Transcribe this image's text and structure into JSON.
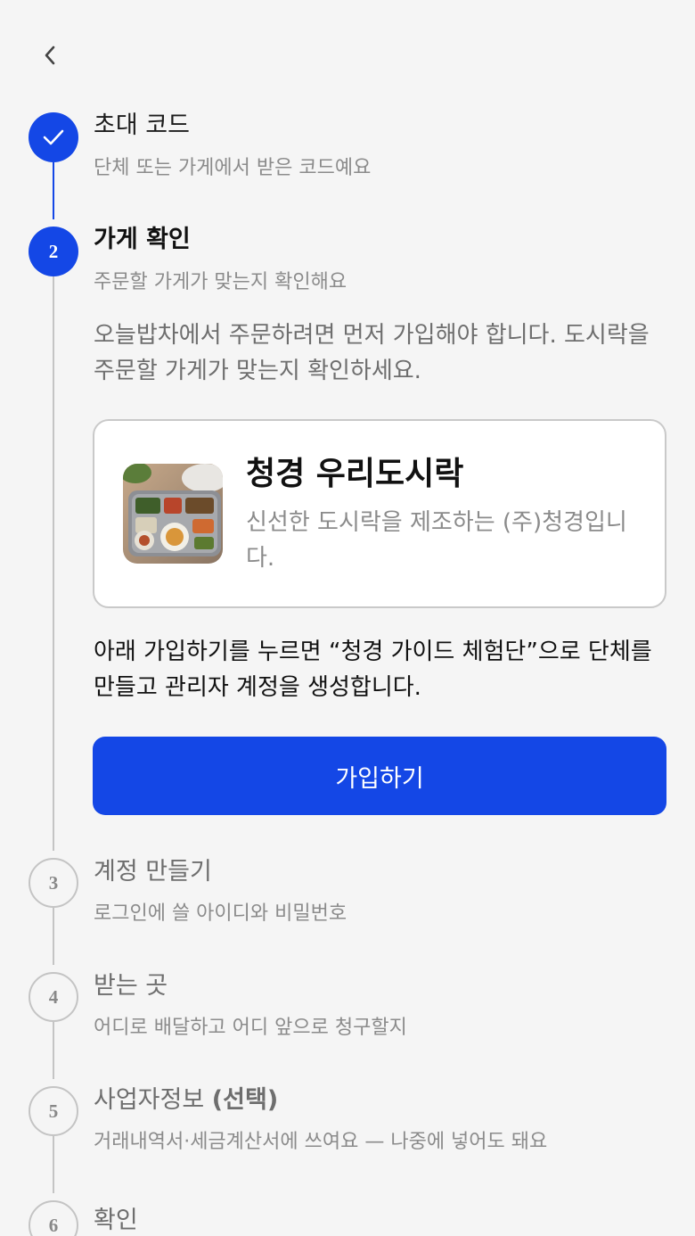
{
  "steps": [
    {
      "number": "",
      "title": "초대 코드",
      "subtitle": "단체 또는 가게에서 받은 코드예요",
      "state": "done"
    },
    {
      "number": "2",
      "title": "가게 확인",
      "subtitle": "주문할 가게가 맞는지 확인해요",
      "state": "active"
    },
    {
      "number": "3",
      "title": "계정 만들기",
      "subtitle": "로그인에 쓸 아이디와 비밀번호",
      "state": "todo"
    },
    {
      "number": "4",
      "title": "받는 곳",
      "subtitle": "어디로 배달하고 어디 앞으로 청구할지",
      "state": "todo"
    },
    {
      "number": "5",
      "title": "사업자정보",
      "title_suffix": "(선택)",
      "subtitle": "거래내역서·세금계산서에 쓰여요 — 나중에 넣어도 돼요",
      "state": "todo"
    },
    {
      "number": "6",
      "title": "확인",
      "subtitle": "",
      "state": "todo"
    }
  ],
  "intro_text": "오늘밥차에서 주문하려면 먼저 가입해야 합니다. 도시락을 주문할 가게가 맞는지 확인하세요.",
  "store": {
    "name": "청경 우리도시락",
    "description": "신선한 도시락을 제조하는 (주)청경입니다."
  },
  "notice_text": "아래 가입하기를 누르면 “청경 가이드 체험단”으로 단체를 만들고 관리자 계정을 생성합니다.",
  "signup_label": "가입하기",
  "icons": {
    "back": "chevron-left-icon",
    "check": "check-icon",
    "store_photo": "lunchbox-photo"
  },
  "colors": {
    "accent": "#1447e6",
    "muted": "#8b8b8b",
    "line": "#c4c4c4",
    "background": "#f5f5f5"
  }
}
